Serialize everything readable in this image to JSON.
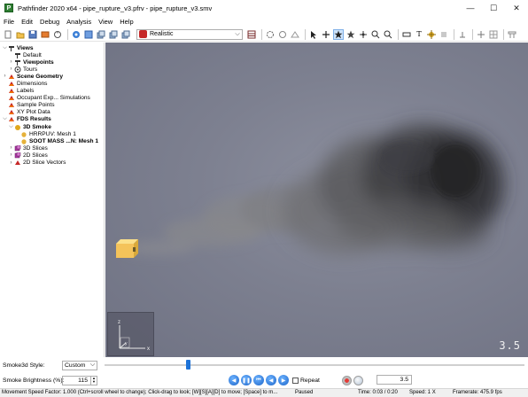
{
  "window": {
    "title": "Pathfinder 2020 x64 - pipe_rupture_v3.pfrv - pipe_rupture_v3.smv",
    "app_icon_letter": "P",
    "controls": {
      "minimize": "—",
      "maximize": "☐",
      "close": "✕"
    }
  },
  "menu": {
    "items": [
      {
        "label": "File",
        "underline": "F"
      },
      {
        "label": "Edit",
        "underline": "E"
      },
      {
        "label": "Debug",
        "underline": "D"
      },
      {
        "label": "Analysis",
        "underline": "A"
      },
      {
        "label": "View",
        "underline": "V"
      },
      {
        "label": "Help",
        "underline": "H"
      }
    ]
  },
  "toolbar": {
    "render_mode": "Realistic",
    "icons": [
      "new-file-icon",
      "open-folder-icon",
      "save-icon",
      "import-icon",
      "reset-view-icon",
      "orbit-icon",
      "zoom-icon",
      "view-top-icon",
      "view-front-icon",
      "view-side-icon",
      "render-mode-icon",
      "table-icon",
      "settings-icon",
      "filter-icon",
      "toggle-icon",
      "select-icon",
      "pan-icon",
      "navigate-icon",
      "fly-icon",
      "move-icon",
      "zoom-in-icon",
      "zoom-out-icon",
      "measure-icon",
      "text-icon",
      "smoke-icon",
      "layers-icon",
      "snapshot-icon",
      "split-icon",
      "grid-icon",
      "camera-icon"
    ]
  },
  "tree": {
    "items": [
      {
        "label": "Views",
        "level": 0,
        "expand": "v",
        "icon": "views-icon",
        "bold": true
      },
      {
        "label": "Default",
        "level": 1,
        "expand": "",
        "icon": "view-default-icon",
        "bold": false
      },
      {
        "label": "Viewpoints",
        "level": 1,
        "expand": ">",
        "icon": "viewpoints-icon",
        "bold": true
      },
      {
        "label": "Tours",
        "level": 1,
        "expand": ">",
        "icon": "tours-icon",
        "bold": false
      },
      {
        "label": "Scene Geometry",
        "level": 0,
        "expand": ">",
        "icon": "geometry-icon",
        "bold": true
      },
      {
        "label": "Dimensions",
        "level": 0,
        "expand": "",
        "icon": "geometry-icon",
        "bold": false
      },
      {
        "label": "Labels",
        "level": 0,
        "expand": "",
        "icon": "geometry-icon",
        "bold": false
      },
      {
        "label": "Occupant Exp... Simulations",
        "level": 0,
        "expand": "",
        "icon": "geometry-icon",
        "bold": false
      },
      {
        "label": "Sample Points",
        "level": 0,
        "expand": "",
        "icon": "geometry-icon",
        "bold": false
      },
      {
        "label": "XY Plot Data",
        "level": 0,
        "expand": "",
        "icon": "geometry-icon",
        "bold": false
      },
      {
        "label": "FDS Results",
        "level": 0,
        "expand": "v",
        "icon": "geometry-icon",
        "bold": true
      },
      {
        "label": "3D Smoke",
        "level": 1,
        "expand": "v",
        "icon": "smoke-folder-icon",
        "bold": true
      },
      {
        "label": "HRRPUV: Mesh 1",
        "level": 2,
        "expand": "",
        "icon": "smoke-item-icon",
        "bold": false
      },
      {
        "label": "SOOT MASS ...N: Mesh 1",
        "level": 2,
        "expand": "",
        "icon": "smoke-item-icon",
        "bold": true
      },
      {
        "label": "3D Slices",
        "level": 1,
        "expand": ">",
        "icon": "slices-icon",
        "bold": false
      },
      {
        "label": "2D Slices",
        "level": 1,
        "expand": ">",
        "icon": "slices-icon",
        "bold": false
      },
      {
        "label": "2D Slice Vectors",
        "level": 1,
        "expand": ">",
        "icon": "vectors-icon",
        "bold": false
      }
    ]
  },
  "viewport": {
    "time_readout": "3.5",
    "axis_labels": {
      "z": "z",
      "x": "x",
      "y": "y"
    }
  },
  "controls": {
    "smoke3d_style_label": "Smoke3d Style:",
    "smoke3d_style_value": "Custom",
    "brightness_label": "Smoke Brightness (%):",
    "brightness_value": "115",
    "timeline_progress": 0.198,
    "repeat_label": "Repeat",
    "repeat_checked": false,
    "time_value": "3.5"
  },
  "status": {
    "hint": "Movement Speed Factor: 1.000 (Ctrl+scroll wheel to change); Click-drag to look; [W][S][A][D] to move; [Space] to m...",
    "state": "Paused",
    "time": "Time: 0:03 / 0:20",
    "speed": "Speed: 1 X",
    "framerate": "Framerate: 475.9 fps"
  },
  "colors": {
    "viewport_bg": "#7d8090",
    "accent": "#1e73d8",
    "smoke_source": "#f4c35a"
  }
}
